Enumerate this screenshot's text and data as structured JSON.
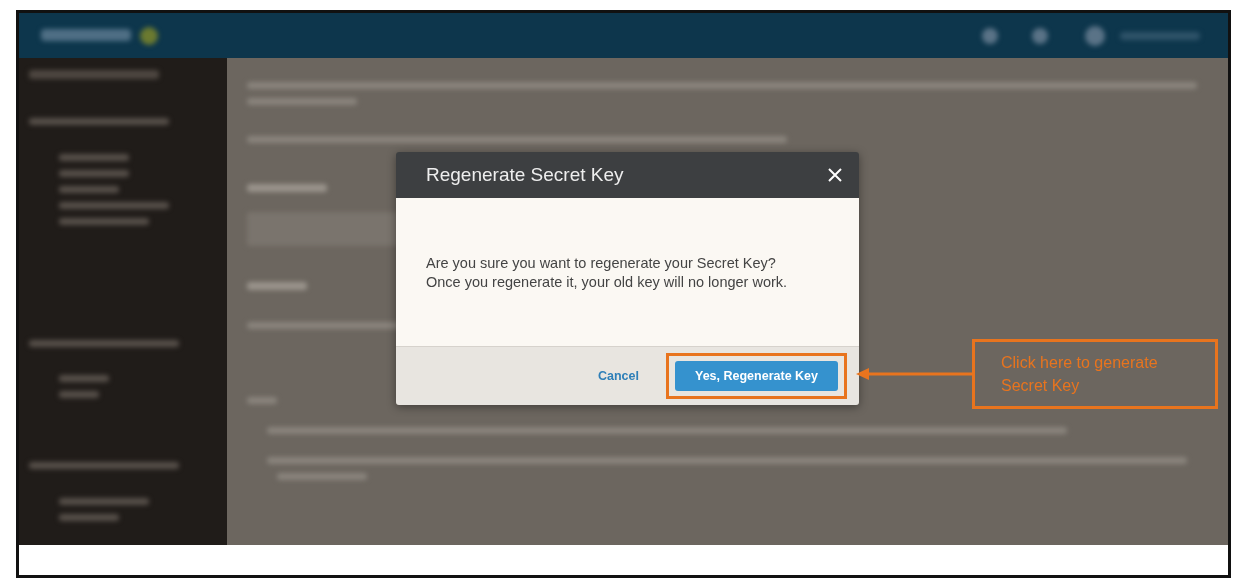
{
  "dialog": {
    "title": "Regenerate Secret Key",
    "message": [
      "Are you sure you want to regenerate your Secret Key?",
      "Once you regenerate it, your old key will no longer work."
    ],
    "buttons": [
      {
        "label": "Cancel",
        "kind": "link",
        "highlighted": false
      },
      {
        "label": "Yes, Regenerate Key",
        "kind": "primary",
        "highlighted": true
      }
    ]
  },
  "callout": {
    "lines": [
      "Click here to generate",
      "Secret Key"
    ]
  }
}
